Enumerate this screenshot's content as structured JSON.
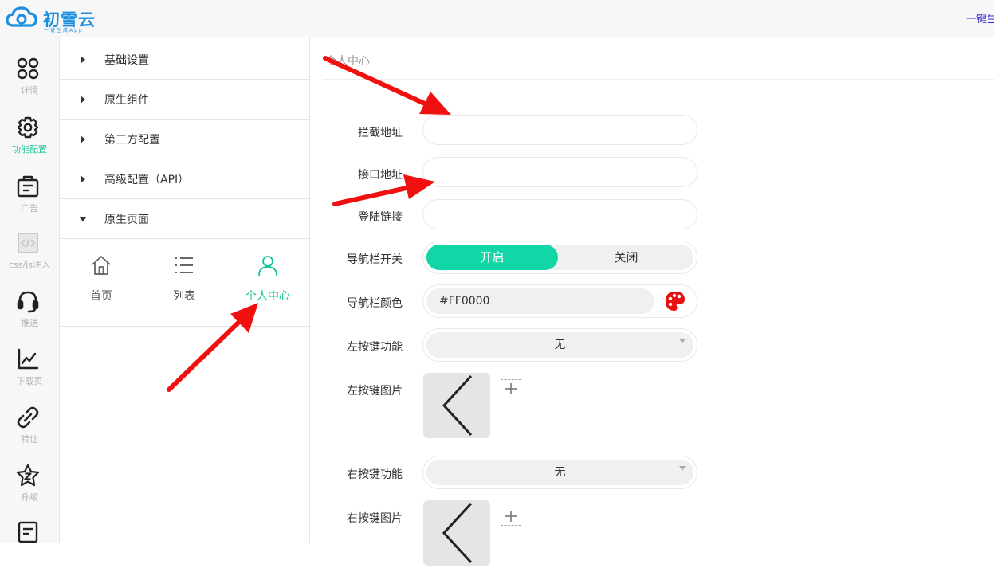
{
  "app": {
    "logo_name": "初雪云",
    "logo_tagline": "一键生成App",
    "top_right_text": "一键生"
  },
  "iconbar": {
    "items": [
      {
        "label": "详情",
        "icon": "grid-icon"
      },
      {
        "label": "功能配置",
        "icon": "gear-icon"
      },
      {
        "label": "广告",
        "icon": "ad-box-icon"
      },
      {
        "label": "css/js注入",
        "icon": "code-file-icon"
      },
      {
        "label": "推送",
        "icon": "headset-icon"
      },
      {
        "label": "下载页",
        "icon": "chart-icon"
      },
      {
        "label": "转让",
        "icon": "link-icon"
      },
      {
        "label": "升级",
        "icon": "star-z-icon"
      },
      {
        "label": "",
        "icon": "document-icon"
      }
    ],
    "active_index": 1
  },
  "menu": {
    "items": [
      {
        "label": "基础设置",
        "expanded": false
      },
      {
        "label": "原生组件",
        "expanded": false
      },
      {
        "label": "第三方配置",
        "expanded": false
      },
      {
        "label": "高级配置（API）",
        "expanded": false
      },
      {
        "label": "原生页面",
        "expanded": true
      }
    ],
    "subnav": [
      {
        "label": "首页",
        "icon": "home-icon"
      },
      {
        "label": "列表",
        "icon": "list-icon"
      },
      {
        "label": "个人中心",
        "icon": "user-icon"
      }
    ],
    "subnav_active_index": 2
  },
  "content": {
    "breadcrumb": "个人中心",
    "form": {
      "intercept_url": {
        "label": "拦截地址",
        "value": ""
      },
      "api_url": {
        "label": "接口地址",
        "value": ""
      },
      "login_link": {
        "label": "登陆链接",
        "value": ""
      },
      "navbar_switch": {
        "label": "导航栏开关",
        "on_label": "开启",
        "off_label": "关闭",
        "selected": "开启"
      },
      "navbar_color": {
        "label": "导航栏颜色",
        "value": "#FF0000"
      },
      "left_button_function": {
        "label": "左按键功能",
        "value": "无"
      },
      "left_button_image": {
        "label": "左按键图片"
      },
      "right_button_function": {
        "label": "右按键功能",
        "value": "无"
      },
      "right_button_image": {
        "label": "右按键图片"
      }
    }
  },
  "colors": {
    "accent": "#12d6a6",
    "active_text": "#12c49a",
    "logo_blue": "#1a8fe0",
    "arrow_red": "#f01010"
  }
}
